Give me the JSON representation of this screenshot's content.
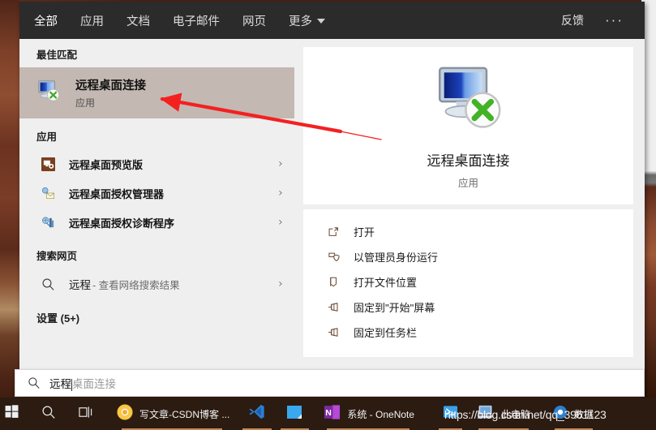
{
  "header": {
    "tabs": [
      {
        "label": "全部",
        "active": true
      },
      {
        "label": "应用",
        "active": false
      },
      {
        "label": "文档",
        "active": false
      },
      {
        "label": "电子邮件",
        "active": false
      },
      {
        "label": "网页",
        "active": false
      },
      {
        "label": "更多",
        "active": false
      }
    ],
    "feedback_label": "反馈",
    "more_dots": "···"
  },
  "left_panel": {
    "best_match_title": "最佳匹配",
    "best_match": {
      "name": "远程桌面连接",
      "type": "应用",
      "icon": "remote-desktop-icon"
    },
    "apps_title": "应用",
    "apps": [
      {
        "name": "远程桌面预览版",
        "icon": "remote-desktop-preview-icon",
        "chevron": "›"
      },
      {
        "name": "远程桌面授权管理器",
        "icon": "license-manager-icon",
        "chevron": "›"
      },
      {
        "name": "远程桌面授权诊断程序",
        "icon": "license-diagnoser-icon",
        "chevron": "›"
      }
    ],
    "web_title": "搜索网页",
    "web_result": {
      "query": "远程",
      "rest": "- 查看网络搜索结果",
      "icon": "search-icon",
      "chevron": "›"
    },
    "settings_title": "设置 (5+)"
  },
  "right_panel": {
    "app_title": "远程桌面连接",
    "app_subtitle": "应用",
    "app_icon": "remote-desktop-icon",
    "actions": [
      {
        "label": "打开",
        "icon": "open-icon"
      },
      {
        "label": "以管理员身份运行",
        "icon": "shield-run-as-admin-icon"
      },
      {
        "label": "打开文件位置",
        "icon": "folder-location-icon"
      },
      {
        "label": "固定到\"开始\"屏幕",
        "icon": "pin-icon"
      },
      {
        "label": "固定到任务栏",
        "icon": "pin-icon"
      }
    ]
  },
  "search_bar": {
    "typed_text": "远程",
    "suggestion_text": "桌面连接",
    "icon": "search-icon"
  },
  "taskbar": {
    "items": [
      {
        "name": "start-button",
        "icon": "windows-logo-icon",
        "label": "",
        "running": false
      },
      {
        "name": "search-button",
        "icon": "search-icon",
        "label": "",
        "running": false
      },
      {
        "name": "task-view-button",
        "icon": "task-view-icon",
        "label": "",
        "running": false
      },
      {
        "name": "chrome-window",
        "icon": "chrome-icon",
        "label": "写文章-CSDN博客 ...",
        "running": true
      },
      {
        "name": "vscode-window",
        "icon": "vscode-icon",
        "label": "",
        "running": true
      },
      {
        "name": "explorer-window",
        "icon": "explorer-icon",
        "label": "",
        "running": true
      },
      {
        "name": "onenote-window",
        "icon": "onenote-icon",
        "label": "系统 - OneNote",
        "running": true
      },
      {
        "name": "terminal-window",
        "icon": "terminal-icon",
        "label": "",
        "running": true
      },
      {
        "name": "this-pc-window",
        "icon": "this-pc-icon",
        "label": "此电脑",
        "running": true
      },
      {
        "name": "datagrip-window",
        "icon": "datagrip-icon",
        "label": "数据",
        "running": true
      }
    ]
  },
  "watermark": {
    "text": "https://blog.csdn.net/qq_3961123"
  },
  "annotation": {
    "arrow_color": "#f42020"
  },
  "colors": {
    "header_bg": "#2b2b2b",
    "panel_bg": "#efefef",
    "card_bg": "#ffffff",
    "highlight_bg": "#c3b8b2",
    "taskbar_bg": "#2b1b11",
    "accent_green": "#4caf22"
  }
}
